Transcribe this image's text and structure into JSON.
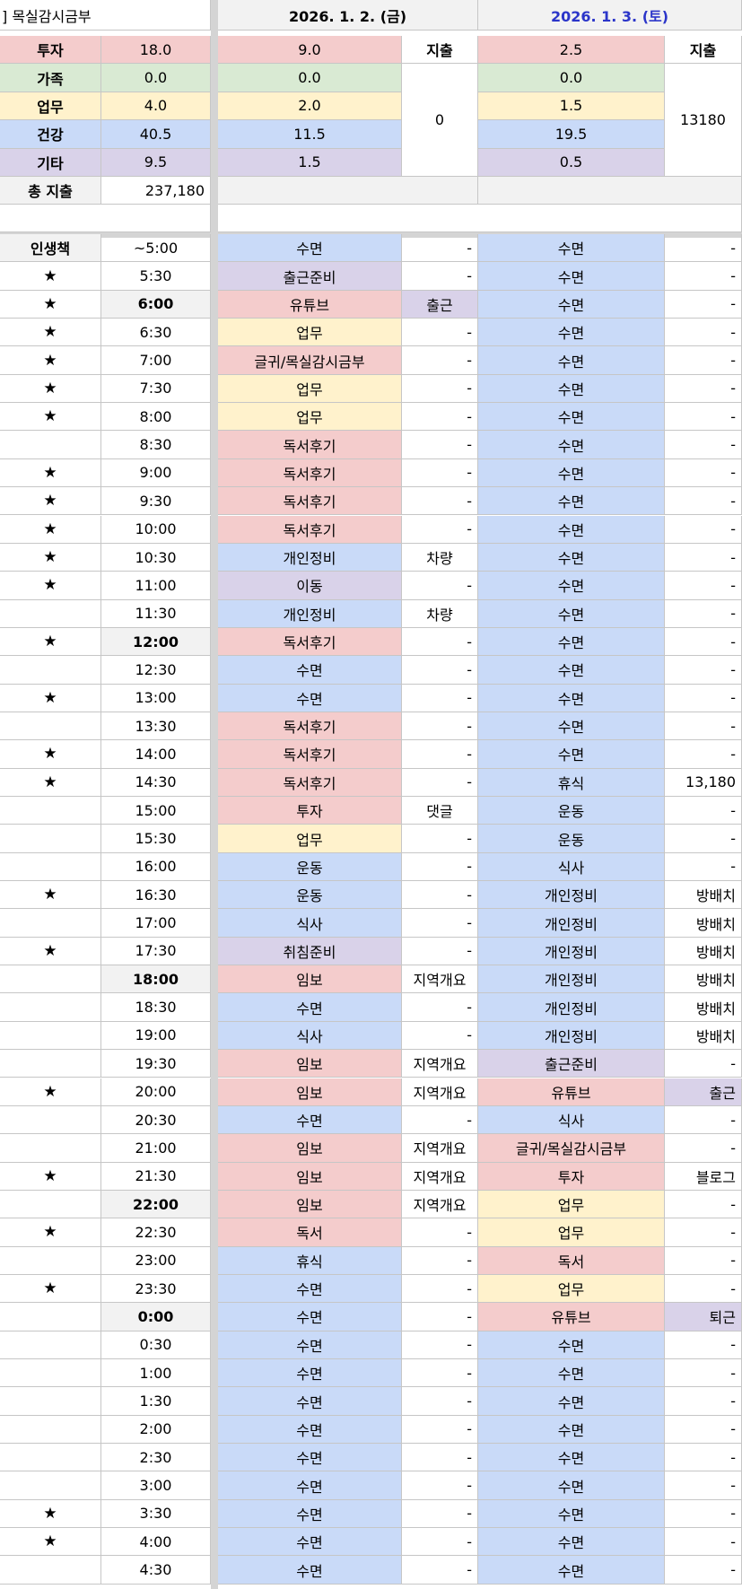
{
  "sheet_title": "] 목실감시금부",
  "dates": [
    {
      "label": "2026. 1. 2. (금)",
      "color": "#000000"
    },
    {
      "label": "2026. 1. 3. (토)",
      "color": "#2b35c9"
    }
  ],
  "colors": {
    "투자": "#f4cccc",
    "가족": "#d9ead3",
    "업무": "#fff2cc",
    "건강": "#c9daf8",
    "기타": "#d9d2e9"
  },
  "summary": {
    "expense_header": "지출",
    "rows": [
      {
        "label": "투자",
        "total": "18.0",
        "day1": "9.0",
        "day2": "2.5"
      },
      {
        "label": "가족",
        "total": "0.0",
        "day1": "0.0",
        "day2": "0.0"
      },
      {
        "label": "업무",
        "total": "4.0",
        "day1": "2.0",
        "day2": "1.5"
      },
      {
        "label": "건강",
        "total": "40.5",
        "day1": "11.5",
        "day2": "19.5"
      },
      {
        "label": "기타",
        "total": "9.5",
        "day1": "1.5",
        "day2": "0.5"
      }
    ],
    "day1_expense": "0",
    "day2_expense": "13180",
    "total_label": "총 지출",
    "total_value": "237,180"
  },
  "schedule_header": "인생책",
  "schedule": [
    {
      "star": "",
      "time": "~5:00",
      "bold": false,
      "a": "수면",
      "ac": "건강",
      "an": "-",
      "b": "수면",
      "bc": "건강",
      "bn": "-"
    },
    {
      "star": "★",
      "time": "5:30",
      "bold": false,
      "a": "출근준비",
      "ac": "기타",
      "an": "-",
      "b": "수면",
      "bc": "건강",
      "bn": "-"
    },
    {
      "star": "★",
      "time": "6:00",
      "bold": true,
      "a": "유튜브",
      "ac": "투자",
      "an": "출근",
      "anc": "기타",
      "b": "수면",
      "bc": "건강",
      "bn": "-"
    },
    {
      "star": "★",
      "time": "6:30",
      "bold": false,
      "a": "업무",
      "ac": "업무",
      "an": "-",
      "b": "수면",
      "bc": "건강",
      "bn": "-"
    },
    {
      "star": "★",
      "time": "7:00",
      "bold": false,
      "a": "글귀/목실감시금부",
      "ac": "투자",
      "an": "-",
      "b": "수면",
      "bc": "건강",
      "bn": "-"
    },
    {
      "star": "★",
      "time": "7:30",
      "bold": false,
      "a": "업무",
      "ac": "업무",
      "an": "-",
      "b": "수면",
      "bc": "건강",
      "bn": "-"
    },
    {
      "star": "★",
      "time": "8:00",
      "bold": false,
      "a": "업무",
      "ac": "업무",
      "an": "-",
      "b": "수면",
      "bc": "건강",
      "bn": "-"
    },
    {
      "star": "",
      "time": "8:30",
      "bold": false,
      "a": "독서후기",
      "ac": "투자",
      "an": "-",
      "b": "수면",
      "bc": "건강",
      "bn": "-"
    },
    {
      "star": "★",
      "time": "9:00",
      "bold": false,
      "a": "독서후기",
      "ac": "투자",
      "an": "-",
      "b": "수면",
      "bc": "건강",
      "bn": "-"
    },
    {
      "star": "★",
      "time": "9:30",
      "bold": false,
      "a": "독서후기",
      "ac": "투자",
      "an": "-",
      "b": "수면",
      "bc": "건강",
      "bn": "-"
    },
    {
      "star": "★",
      "time": "10:00",
      "bold": false,
      "a": "독서후기",
      "ac": "투자",
      "an": "-",
      "b": "수면",
      "bc": "건강",
      "bn": "-"
    },
    {
      "star": "★",
      "time": "10:30",
      "bold": false,
      "a": "개인정비",
      "ac": "건강",
      "an": "차량",
      "b": "수면",
      "bc": "건강",
      "bn": "-"
    },
    {
      "star": "★",
      "time": "11:00",
      "bold": false,
      "a": "이동",
      "ac": "기타",
      "an": "-",
      "b": "수면",
      "bc": "건강",
      "bn": "-"
    },
    {
      "star": "",
      "time": "11:30",
      "bold": false,
      "a": "개인정비",
      "ac": "건강",
      "an": "차량",
      "b": "수면",
      "bc": "건강",
      "bn": "-"
    },
    {
      "star": "★",
      "time": "12:00",
      "bold": true,
      "a": "독서후기",
      "ac": "투자",
      "an": "-",
      "b": "수면",
      "bc": "건강",
      "bn": "-"
    },
    {
      "star": "",
      "time": "12:30",
      "bold": false,
      "a": "수면",
      "ac": "건강",
      "an": "-",
      "b": "수면",
      "bc": "건강",
      "bn": "-"
    },
    {
      "star": "★",
      "time": "13:00",
      "bold": false,
      "a": "수면",
      "ac": "건강",
      "an": "-",
      "b": "수면",
      "bc": "건강",
      "bn": "-"
    },
    {
      "star": "",
      "time": "13:30",
      "bold": false,
      "a": "독서후기",
      "ac": "투자",
      "an": "-",
      "b": "수면",
      "bc": "건강",
      "bn": "-"
    },
    {
      "star": "★",
      "time": "14:00",
      "bold": false,
      "a": "독서후기",
      "ac": "투자",
      "an": "-",
      "b": "수면",
      "bc": "건강",
      "bn": "-"
    },
    {
      "star": "★",
      "time": "14:30",
      "bold": false,
      "a": "독서후기",
      "ac": "투자",
      "an": "-",
      "b": "휴식",
      "bc": "건강",
      "bn": "13,180"
    },
    {
      "star": "",
      "time": "15:00",
      "bold": false,
      "a": "투자",
      "ac": "투자",
      "an": "댓글",
      "b": "운동",
      "bc": "건강",
      "bn": "-"
    },
    {
      "star": "",
      "time": "15:30",
      "bold": false,
      "a": "업무",
      "ac": "업무",
      "an": "-",
      "b": "운동",
      "bc": "건강",
      "bn": "-"
    },
    {
      "star": "",
      "time": "16:00",
      "bold": false,
      "a": "운동",
      "ac": "건강",
      "an": "-",
      "b": "식사",
      "bc": "건강",
      "bn": "-"
    },
    {
      "star": "★",
      "time": "16:30",
      "bold": false,
      "a": "운동",
      "ac": "건강",
      "an": "-",
      "b": "개인정비",
      "bc": "건강",
      "bn": "방배치"
    },
    {
      "star": "",
      "time": "17:00",
      "bold": false,
      "a": "식사",
      "ac": "건강",
      "an": "-",
      "b": "개인정비",
      "bc": "건강",
      "bn": "방배치"
    },
    {
      "star": "★",
      "time": "17:30",
      "bold": false,
      "a": "취침준비",
      "ac": "기타",
      "an": "-",
      "b": "개인정비",
      "bc": "건강",
      "bn": "방배치"
    },
    {
      "star": "",
      "time": "18:00",
      "bold": true,
      "a": "임보",
      "ac": "투자",
      "an": "지역개요",
      "b": "개인정비",
      "bc": "건강",
      "bn": "방배치"
    },
    {
      "star": "",
      "time": "18:30",
      "bold": false,
      "a": "수면",
      "ac": "건강",
      "an": "-",
      "b": "개인정비",
      "bc": "건강",
      "bn": "방배치"
    },
    {
      "star": "",
      "time": "19:00",
      "bold": false,
      "a": "식사",
      "ac": "건강",
      "an": "-",
      "b": "개인정비",
      "bc": "건강",
      "bn": "방배치"
    },
    {
      "star": "",
      "time": "19:30",
      "bold": false,
      "a": "임보",
      "ac": "투자",
      "an": "지역개요",
      "b": "출근준비",
      "bc": "기타",
      "bn": "-"
    },
    {
      "star": "★",
      "time": "20:00",
      "bold": false,
      "a": "임보",
      "ac": "투자",
      "an": "지역개요",
      "b": "유튜브",
      "bc": "투자",
      "bn": "출근",
      "bnc": "기타"
    },
    {
      "star": "",
      "time": "20:30",
      "bold": false,
      "a": "수면",
      "ac": "건강",
      "an": "-",
      "b": "식사",
      "bc": "건강",
      "bn": "-"
    },
    {
      "star": "",
      "time": "21:00",
      "bold": false,
      "a": "임보",
      "ac": "투자",
      "an": "지역개요",
      "b": "글귀/목실감시금부",
      "bc": "투자",
      "bn": "-"
    },
    {
      "star": "★",
      "time": "21:30",
      "bold": false,
      "a": "임보",
      "ac": "투자",
      "an": "지역개요",
      "b": "투자",
      "bc": "투자",
      "bn": "블로그"
    },
    {
      "star": "",
      "time": "22:00",
      "bold": true,
      "a": "임보",
      "ac": "투자",
      "an": "지역개요",
      "b": "업무",
      "bc": "업무",
      "bn": "-"
    },
    {
      "star": "★",
      "time": "22:30",
      "bold": false,
      "a": "독서",
      "ac": "투자",
      "an": "-",
      "b": "업무",
      "bc": "업무",
      "bn": "-"
    },
    {
      "star": "",
      "time": "23:00",
      "bold": false,
      "a": "휴식",
      "ac": "건강",
      "an": "-",
      "b": "독서",
      "bc": "투자",
      "bn": "-"
    },
    {
      "star": "★",
      "time": "23:30",
      "bold": false,
      "a": "수면",
      "ac": "건강",
      "an": "-",
      "b": "업무",
      "bc": "업무",
      "bn": "-"
    },
    {
      "star": "",
      "time": "0:00",
      "bold": true,
      "a": "수면",
      "ac": "건강",
      "an": "-",
      "b": "유튜브",
      "bc": "투자",
      "bn": "퇴근",
      "bnc": "기타"
    },
    {
      "star": "",
      "time": "0:30",
      "bold": false,
      "a": "수면",
      "ac": "건강",
      "an": "-",
      "b": "수면",
      "bc": "건강",
      "bn": "-"
    },
    {
      "star": "",
      "time": "1:00",
      "bold": false,
      "a": "수면",
      "ac": "건강",
      "an": "-",
      "b": "수면",
      "bc": "건강",
      "bn": "-"
    },
    {
      "star": "",
      "time": "1:30",
      "bold": false,
      "a": "수면",
      "ac": "건강",
      "an": "-",
      "b": "수면",
      "bc": "건강",
      "bn": "-"
    },
    {
      "star": "",
      "time": "2:00",
      "bold": false,
      "a": "수면",
      "ac": "건강",
      "an": "-",
      "b": "수면",
      "bc": "건강",
      "bn": "-"
    },
    {
      "star": "",
      "time": "2:30",
      "bold": false,
      "a": "수면",
      "ac": "건강",
      "an": "-",
      "b": "수면",
      "bc": "건강",
      "bn": "-"
    },
    {
      "star": "",
      "time": "3:00",
      "bold": false,
      "a": "수면",
      "ac": "건강",
      "an": "-",
      "b": "수면",
      "bc": "건강",
      "bn": "-"
    },
    {
      "star": "★",
      "time": "3:30",
      "bold": false,
      "a": "수면",
      "ac": "건강",
      "an": "-",
      "b": "수면",
      "bc": "건강",
      "bn": "-"
    },
    {
      "star": "★",
      "time": "4:00",
      "bold": false,
      "a": "수면",
      "ac": "건강",
      "an": "-",
      "b": "수면",
      "bc": "건강",
      "bn": "-"
    },
    {
      "star": "",
      "time": "4:30",
      "bold": false,
      "a": "수면",
      "ac": "건강",
      "an": "-",
      "b": "수면",
      "bc": "건강",
      "bn": "-"
    }
  ]
}
